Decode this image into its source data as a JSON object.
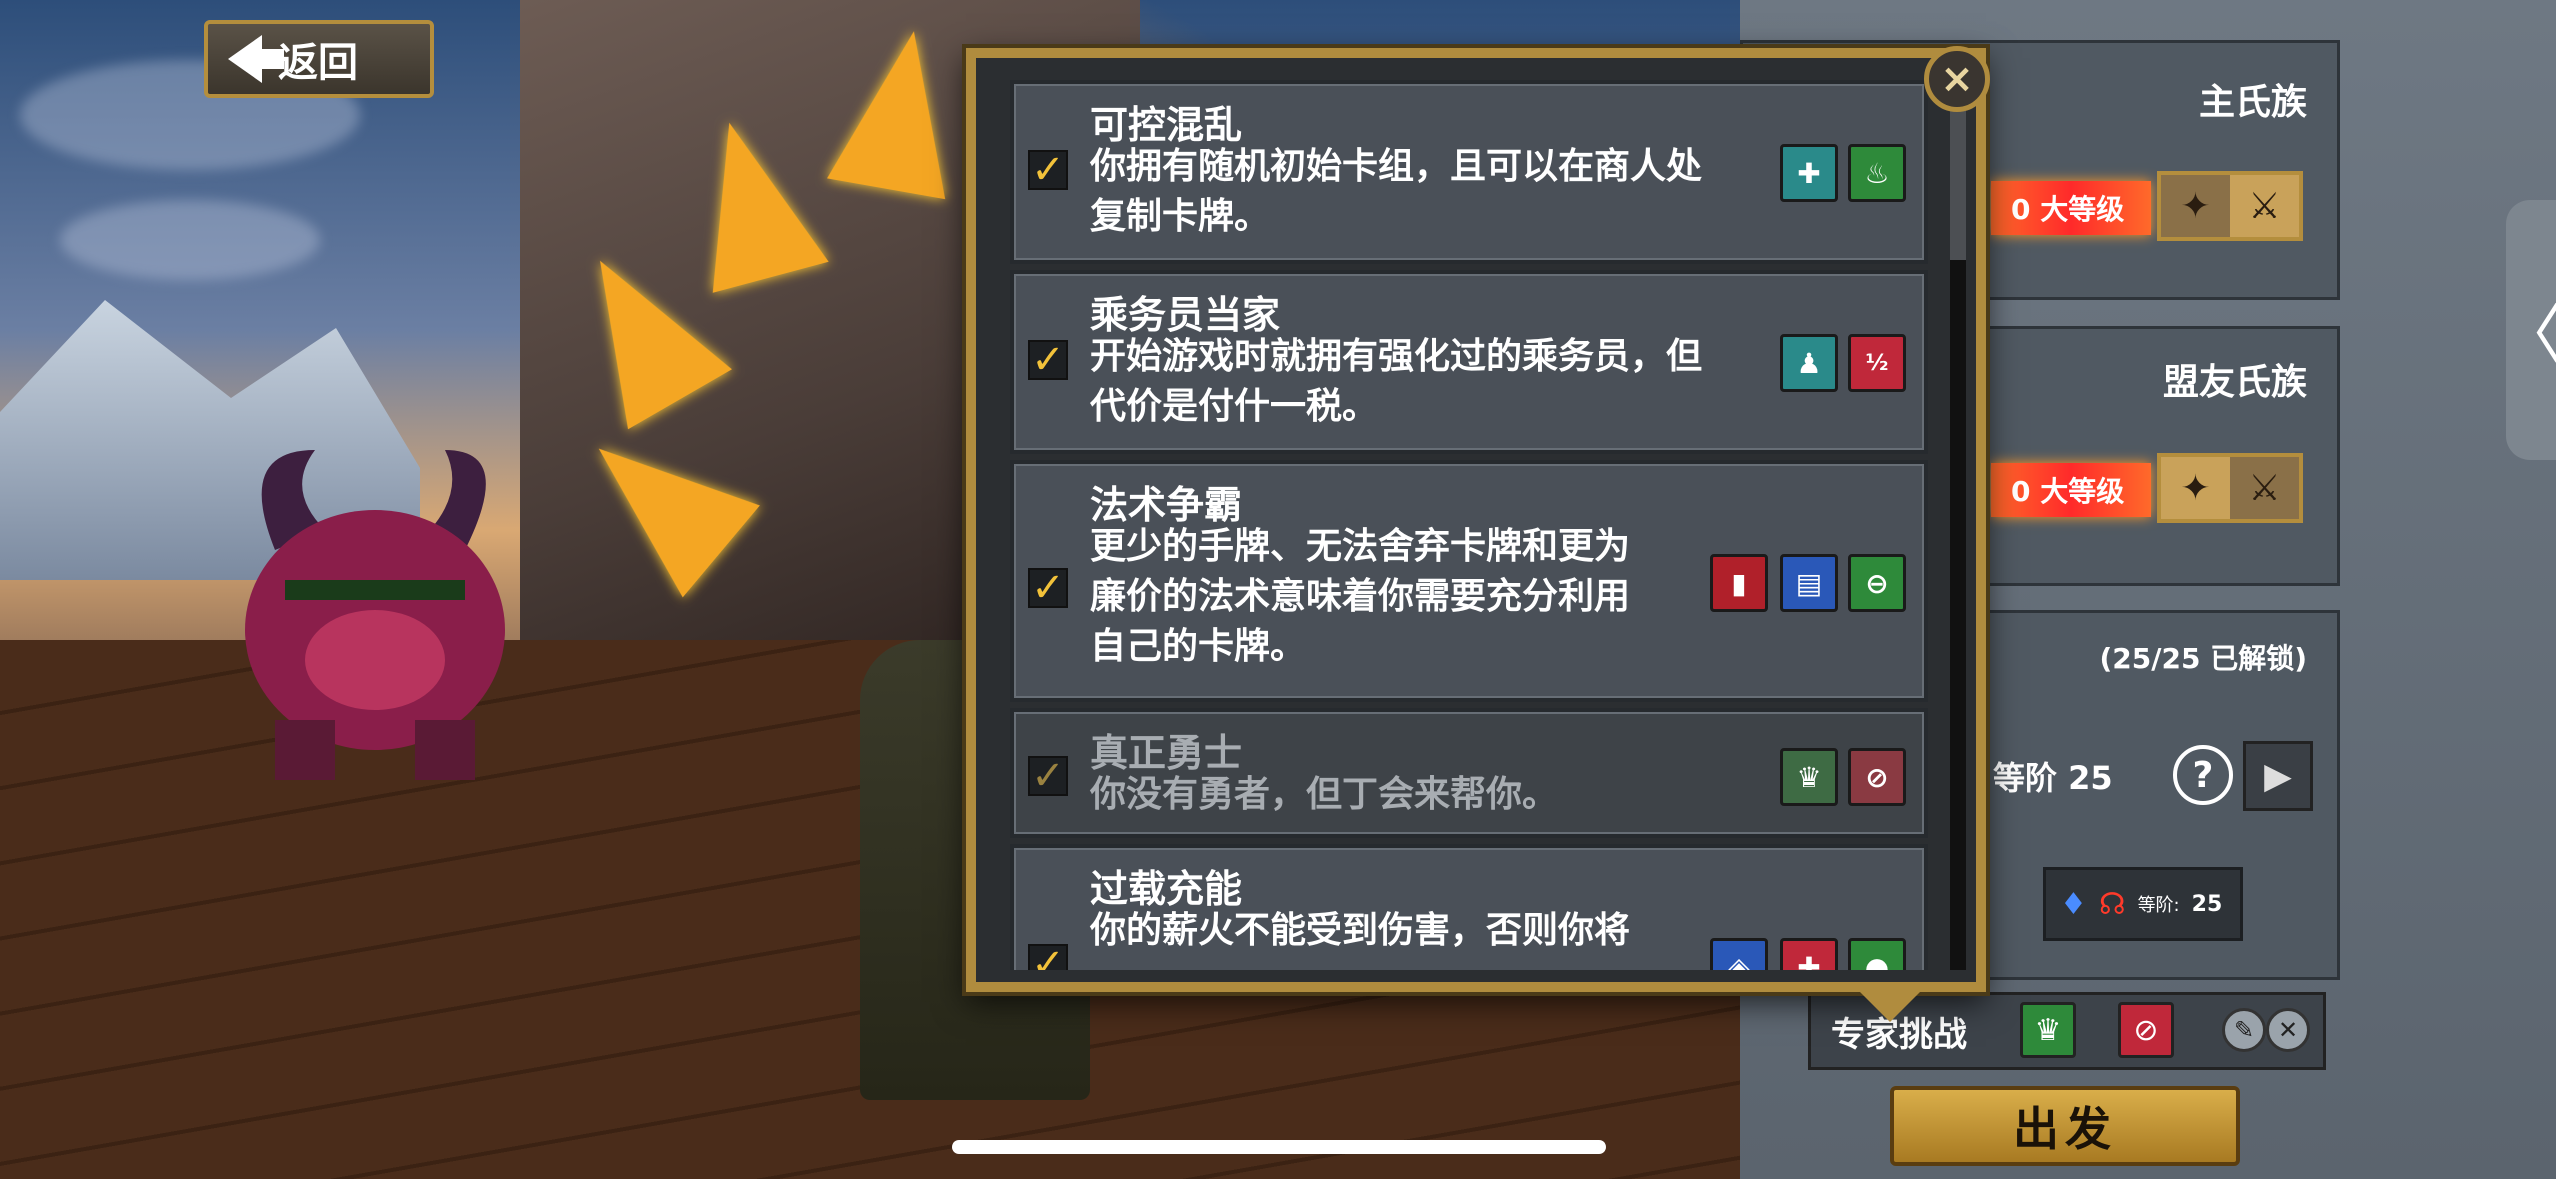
{
  "back_button": {
    "label": "返回"
  },
  "modal": {
    "items": [
      {
        "title": "可控混乱",
        "desc": [
          "你拥有随机初始卡组，且可以在商人处",
          "复制卡牌。"
        ],
        "checked": true,
        "icons": [
          "card-plus-icon",
          "cauldron-icon"
        ]
      },
      {
        "title": "乘务员当家",
        "desc": [
          "开始游戏时就拥有强化过的乘务员，但",
          "代价是付什一税。"
        ],
        "checked": true,
        "icons": [
          "crew-upgrade-icon",
          "half-tax-icon"
        ]
      },
      {
        "title": "法术争霸",
        "desc": [
          "更少的手牌、无法舍弃卡牌和更为",
          "廉价的法术意味着你需要充分利用",
          "自己的卡牌。"
        ],
        "checked": true,
        "icons": [
          "red-card-icon",
          "blue-cards-icon",
          "no-discard-icon"
        ]
      },
      {
        "title": "真正勇士",
        "desc": [
          "你没有勇者，但丁会来帮你。"
        ],
        "checked": true,
        "disabled": true,
        "icons": [
          "hat-icon",
          "no-champion-icon"
        ]
      },
      {
        "title": "过载充能",
        "desc": [
          "你的薪火不能受到伤害，否则你将"
        ],
        "checked": true,
        "icons": [
          "shield-icon",
          "heal-icon",
          "charge-icon"
        ]
      }
    ],
    "close_symbol": "×"
  },
  "right_panel": {
    "main_clan": {
      "title": "主氏族",
      "level_text": "0 大等级"
    },
    "allied_clan": {
      "title": "盟友氏族",
      "level_text": "0 大等级"
    },
    "covenant": {
      "unlocked": "(25/25 已解锁)",
      "tier": "等阶 25",
      "help": "?",
      "next": "▶"
    },
    "difficulty": {
      "label": "等阶:",
      "value": "25"
    },
    "expert_challenge": {
      "label": "专家挑战"
    },
    "go_button": {
      "label": "出发"
    },
    "side_tab": "〈"
  },
  "colors": {
    "accent_gold": "#b08c3e",
    "check": "#f2c23a",
    "level_red": "#ff2a2a"
  }
}
